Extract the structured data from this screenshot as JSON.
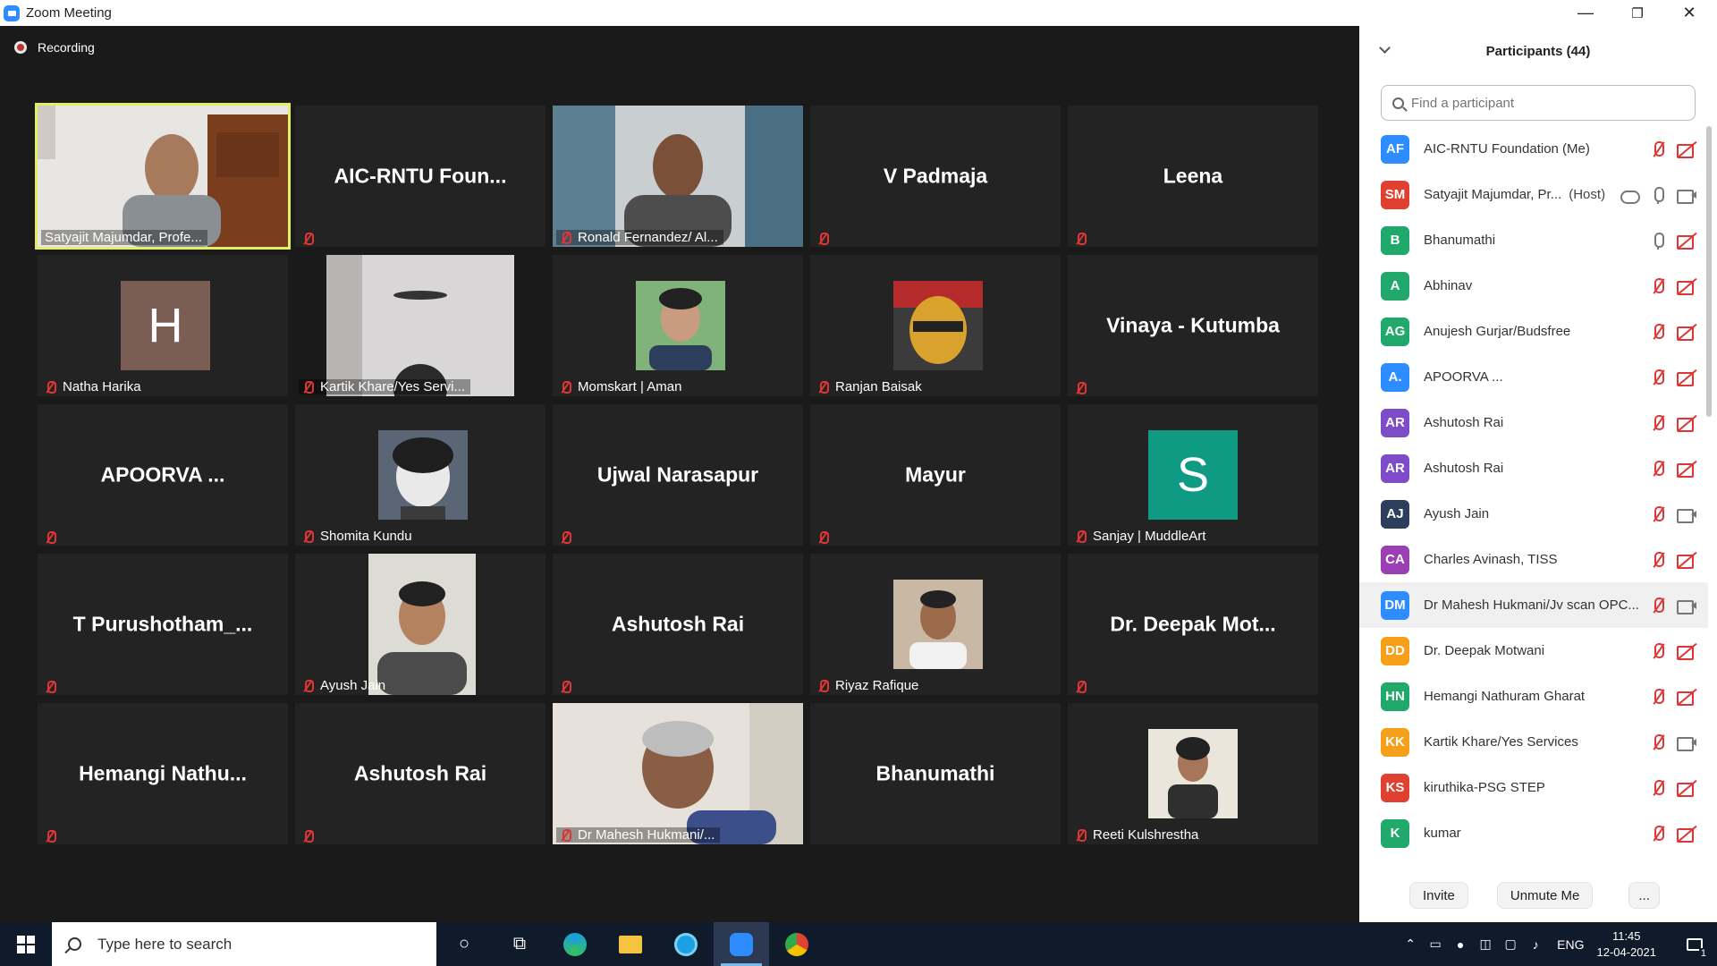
{
  "window": {
    "title": "Zoom Meeting",
    "min": "—",
    "max": "❐",
    "close": "✕"
  },
  "recording": {
    "label": "Recording"
  },
  "tiles": [
    {
      "name": "Satyajit Majumdar, Profe...",
      "video": true,
      "active": true
    },
    {
      "name": "AIC-RNTU  Foun...",
      "video": false
    },
    {
      "name": "Ronald Fernandez/ Al...",
      "video": true
    },
    {
      "name": "V Padmaja",
      "video": false
    },
    {
      "name": "Leena",
      "video": false
    },
    {
      "name": "Natha Harika",
      "avatar_letter": "H"
    },
    {
      "name": "Kartik Khare/Yes Servi...",
      "video": true
    },
    {
      "name": "Momskart | Aman",
      "photo": true
    },
    {
      "name": "Ranjan Baisak",
      "photo": true
    },
    {
      "name": "Vinaya - Kutumba",
      "video": false
    },
    {
      "name": "APOORVA ...",
      "video": false
    },
    {
      "name": "Shomita Kundu",
      "photo": true
    },
    {
      "name": "Ujwal Narasapur",
      "video": false
    },
    {
      "name": "Mayur",
      "video": false
    },
    {
      "name": "Sanjay | MuddleArt",
      "avatar_letter": "S"
    },
    {
      "name": "T  Purushotham_...",
      "video": false
    },
    {
      "name": "Ayush Jain",
      "video": true
    },
    {
      "name": "Ashutosh Rai",
      "video": false
    },
    {
      "name": "Riyaz Rafique",
      "photo": true
    },
    {
      "name": "Dr. Deepak  Mot...",
      "video": false
    },
    {
      "name": "Hemangi  Nathu...",
      "video": false
    },
    {
      "name": "Ashutosh Rai",
      "video": false
    },
    {
      "name": "Dr Mahesh Hukmani/...",
      "video": true
    },
    {
      "name": "Bhanumathi",
      "video": false
    },
    {
      "name": "Reeti Kulshrestha",
      "photo": true
    }
  ],
  "panel": {
    "title": "Participants (44)",
    "search_placeholder": "Find a participant",
    "participants": [
      {
        "initials": "AF",
        "name": "AIC-RNTU Foundation (Me)",
        "color": "#2d8cff",
        "mic": "off",
        "cam": "off"
      },
      {
        "initials": "SM",
        "name": "Satyajit Majumdar, Pr...",
        "tag": "(Host)",
        "color": "#e0402f",
        "mic": "on",
        "cam": "on",
        "cloud": true
      },
      {
        "initials": "B",
        "name": "Bhanumathi",
        "color": "#20a96b",
        "mic": "on",
        "cam": "off"
      },
      {
        "initials": "A",
        "name": "Abhinav",
        "color": "#20a96b",
        "mic": "off",
        "cam": "off"
      },
      {
        "initials": "AG",
        "name": "Anujesh Gurjar/Budsfree",
        "color": "#20a96b",
        "mic": "off",
        "cam": "off"
      },
      {
        "initials": "A.",
        "name": "APOORVA ...",
        "color": "#2d8cff",
        "mic": "off",
        "cam": "off"
      },
      {
        "initials": "AR",
        "name": "Ashutosh Rai",
        "color": "#7e4cc9",
        "mic": "off",
        "cam": "off"
      },
      {
        "initials": "AR",
        "name": "Ashutosh Rai",
        "color": "#7e4cc9",
        "mic": "off",
        "cam": "off"
      },
      {
        "initials": "AJ",
        "name": "Ayush Jain",
        "color": "#2c3e5c",
        "mic": "off",
        "cam": "on"
      },
      {
        "initials": "CA",
        "name": "Charles Avinash, TISS",
        "color": "#9b3fb5",
        "mic": "off",
        "cam": "off"
      },
      {
        "initials": "DM",
        "name": "Dr Mahesh Hukmani/Jv scan OPC...",
        "color": "#2d8cff",
        "mic": "off",
        "cam": "on",
        "highlight": true
      },
      {
        "initials": "DD",
        "name": "Dr. Deepak Motwani",
        "color": "#f59f1a",
        "mic": "off",
        "cam": "off"
      },
      {
        "initials": "HN",
        "name": "Hemangi Nathuram Gharat",
        "color": "#20a96b",
        "mic": "off",
        "cam": "off"
      },
      {
        "initials": "KK",
        "name": "Kartik Khare/Yes Services",
        "color": "#f59f1a",
        "mic": "off",
        "cam": "on"
      },
      {
        "initials": "KS",
        "name": "kiruthika-PSG STEP",
        "color": "#e0402f",
        "mic": "off",
        "cam": "off"
      },
      {
        "initials": "K",
        "name": "kumar",
        "color": "#20a96b",
        "mic": "off",
        "cam": "off"
      }
    ],
    "buttons": {
      "invite": "Invite",
      "unmute": "Unmute Me",
      "more": "..."
    }
  },
  "taskbar": {
    "search_placeholder": "Type here to search",
    "lang": "ENG",
    "time": "11:45",
    "date": "12-04-2021",
    "notifications": "1"
  }
}
